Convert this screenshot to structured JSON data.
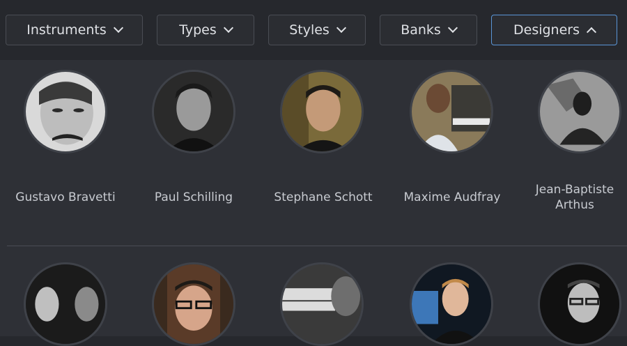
{
  "filters": [
    {
      "label": "Instruments",
      "expanded": false
    },
    {
      "label": "Types",
      "expanded": false
    },
    {
      "label": "Styles",
      "expanded": false
    },
    {
      "label": "Banks",
      "expanded": false
    },
    {
      "label": "Designers",
      "expanded": true
    }
  ],
  "designers_row1": [
    {
      "name": "Gustavo Bravetti"
    },
    {
      "name": "Paul Schilling"
    },
    {
      "name": "Stephane Schott"
    },
    {
      "name": "Maxime Audfray"
    },
    {
      "name": "Jean-Baptiste Arthus"
    }
  ],
  "colors": {
    "background": "#26282d",
    "panel": "#2e3036",
    "active_border": "#5a96d8"
  }
}
